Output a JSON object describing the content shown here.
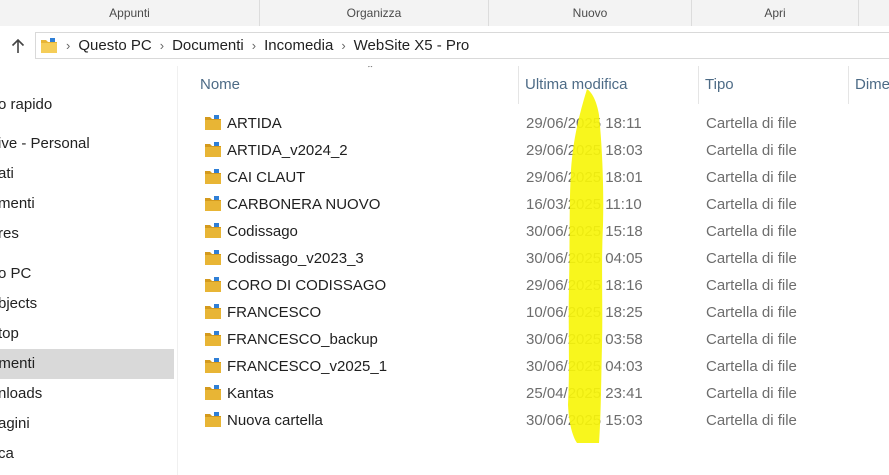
{
  "ribbon": {
    "groups": [
      "Appunti",
      "Organizza",
      "Nuovo",
      "Apri"
    ]
  },
  "address": {
    "crumbs": [
      "Questo PC",
      "Documenti",
      "Incomedia",
      "WebSite X5 - Pro"
    ],
    "separator": "›"
  },
  "sidebar": {
    "items": [
      "o rapido",
      "ive - Personal",
      "ati",
      "menti",
      "res",
      "o PC",
      "bjects",
      "top",
      "umenti",
      "nloads",
      "agini",
      "ca"
    ],
    "selected_index": 8
  },
  "columns": {
    "name": "Nome",
    "modified": "Ultima modifica",
    "type": "Tipo",
    "size": "Dime"
  },
  "files": [
    {
      "name": "ARTIDA",
      "modified": "29/06/2025 18:11",
      "type": "Cartella di file"
    },
    {
      "name": "ARTIDA_v2024_2",
      "modified": "29/06/2025 18:03",
      "type": "Cartella di file"
    },
    {
      "name": "CAI CLAUT",
      "modified": "29/06/2025 18:01",
      "type": "Cartella di file"
    },
    {
      "name": "CARBONERA NUOVO",
      "modified": "16/03/2025 11:10",
      "type": "Cartella di file"
    },
    {
      "name": "Codissago",
      "modified": "30/06/2025 15:18",
      "type": "Cartella di file"
    },
    {
      "name": "Codissago_v2023_3",
      "modified": "30/06/2025 04:05",
      "type": "Cartella di file"
    },
    {
      "name": "CORO DI CODISSAGO",
      "modified": "29/06/2025 18:16",
      "type": "Cartella di file"
    },
    {
      "name": "FRANCESCO",
      "modified": "10/06/2025 18:25",
      "type": "Cartella di file"
    },
    {
      "name": "FRANCESCO_backup",
      "modified": "30/06/2025 03:58",
      "type": "Cartella di file"
    },
    {
      "name": "FRANCESCO_v2025_1",
      "modified": "30/06/2025 04:03",
      "type": "Cartella di file"
    },
    {
      "name": "Kantas",
      "modified": "25/04/2025 23:41",
      "type": "Cartella di file"
    },
    {
      "name": "Nuova cartella",
      "modified": "30/06/2025 15:03",
      "type": "Cartella di file"
    }
  ],
  "colors": {
    "folder": "#e8b535",
    "folder_dark": "#d49a1d",
    "accent_blue": "#2f7fd6",
    "highlighter": "#f7f50a",
    "selected_bg": "#d9d9d9"
  }
}
